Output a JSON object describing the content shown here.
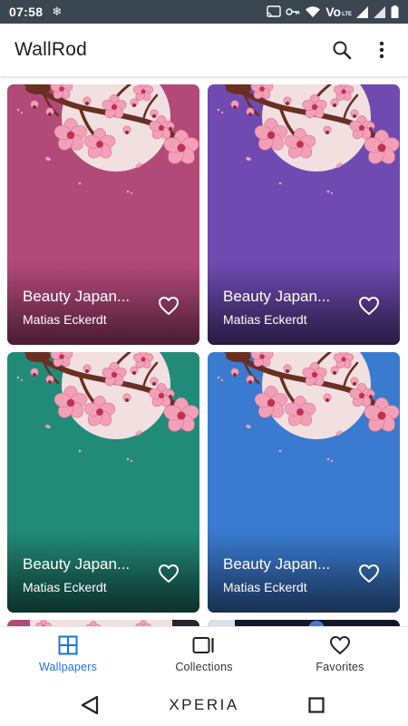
{
  "status_bar": {
    "time": "07:58",
    "left_icon": "snowflake-icon",
    "right_icons": [
      "cast-icon",
      "key-icon",
      "wifi-icon",
      "volte-icon",
      "signal-icon",
      "signal-icon",
      "battery-icon"
    ],
    "volte_text": "Vo",
    "volte_sub": "LTE"
  },
  "app_bar": {
    "title": "WallRod",
    "search_icon": "search-icon",
    "menu_icon": "more-vert-icon"
  },
  "wallpapers": [
    {
      "title": "Beauty Japan...",
      "author": "Matias Eckerdt",
      "bg": "#b24a78",
      "bg_dark": "#7a2f52"
    },
    {
      "title": "Beauty Japan...",
      "author": "Matias Eckerdt",
      "bg": "#6f4bb1",
      "bg_dark": "#3f2c6a"
    },
    {
      "title": "Beauty Japan...",
      "author": "Matias Eckerdt",
      "bg": "#228b78",
      "bg_dark": "#144f44"
    },
    {
      "title": "Beauty Japan...",
      "author": "Matias Eckerdt",
      "bg": "#3a7bd0",
      "bg_dark": "#274f83"
    }
  ],
  "bottom_nav": [
    {
      "label": "Wallpapers",
      "icon": "grid-icon",
      "active": true
    },
    {
      "label": "Collections",
      "icon": "collections-icon",
      "active": false
    },
    {
      "label": "Favorites",
      "icon": "heart-icon",
      "active": false
    }
  ],
  "system_nav": {
    "brand": "XPERIA",
    "back_icon": "back-triangle-icon",
    "recents_icon": "recents-square-icon"
  },
  "colors": {
    "accent": "#1a73e8",
    "status_bar": "#3a4650",
    "petal": "#f2a0b8",
    "moon": "#f1e0df",
    "branch": "#6a2e22"
  }
}
